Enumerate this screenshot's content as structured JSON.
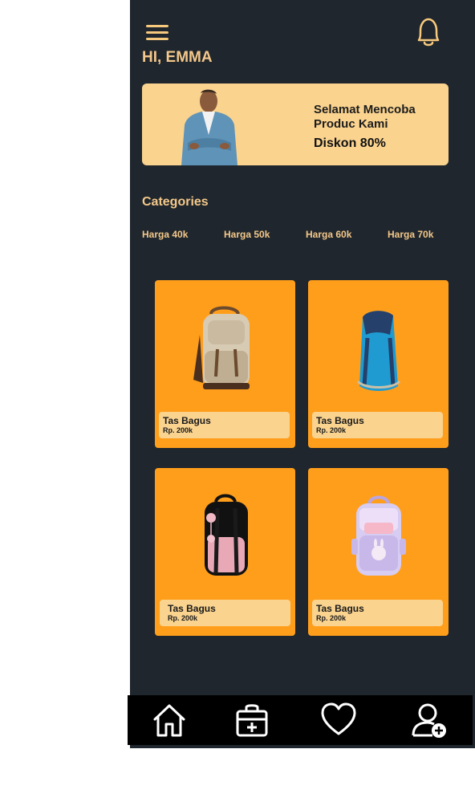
{
  "header": {
    "greeting": "HI, EMMA",
    "menu_icon": "hamburger-menu-icon",
    "notification_icon": "bell-icon"
  },
  "banner": {
    "line1": "Selamat Mencoba Produc Kami",
    "line2": "Diskon 80%"
  },
  "categories": {
    "title": "Categories",
    "items": [
      {
        "label": "Harga 40k"
      },
      {
        "label": "Harga 50k"
      },
      {
        "label": "Harga 60k"
      },
      {
        "label": "Harga 70k"
      }
    ]
  },
  "products": [
    {
      "name": "Tas Bagus",
      "price": "Rp. 200k",
      "image": "beige-backpack"
    },
    {
      "name": "Tas Bagus",
      "price": "Rp. 200k",
      "image": "blue-backpack"
    },
    {
      "name": "Tas Bagus",
      "price": "Rp. 200k",
      "image": "pink-black-backpack"
    },
    {
      "name": "Tas Bagus",
      "price": "Rp. 200k",
      "image": "lavender-backpack"
    }
  ],
  "nav": [
    {
      "icon": "home-icon"
    },
    {
      "icon": "bag-plus-icon"
    },
    {
      "icon": "heart-icon"
    },
    {
      "icon": "user-add-icon"
    }
  ],
  "colors": {
    "background": "#1f262d",
    "accent": "#ff9e1b",
    "soft": "#fad38f",
    "text_accent": "#f4c88a"
  }
}
